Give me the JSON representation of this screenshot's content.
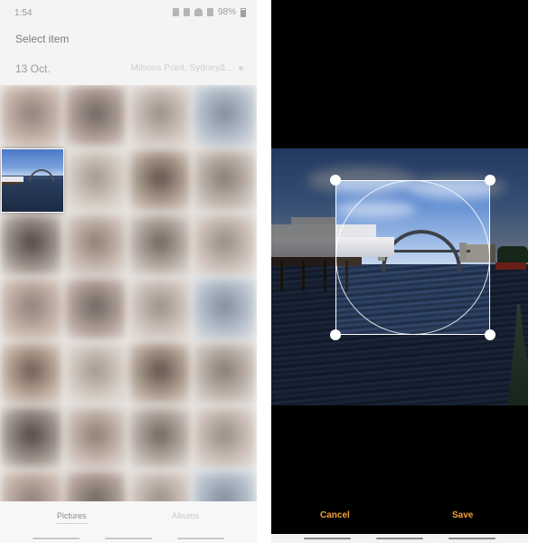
{
  "gallery": {
    "status_time": "1:54",
    "battery": "98%",
    "title": "Select item",
    "date": "13 Oct.",
    "location": "Milsons Point, Sydney&..."
  },
  "tabs": {
    "pictures": "Pictures",
    "albums": "Albums"
  },
  "crop": {
    "cancel_label": "Cancel",
    "save_label": "Save",
    "accent_color": "#f4a03a"
  },
  "icons": [
    "bluetooth-icon",
    "mute-icon",
    "wifi-icon",
    "signal-icon",
    "battery-icon",
    "location-pin-icon"
  ]
}
